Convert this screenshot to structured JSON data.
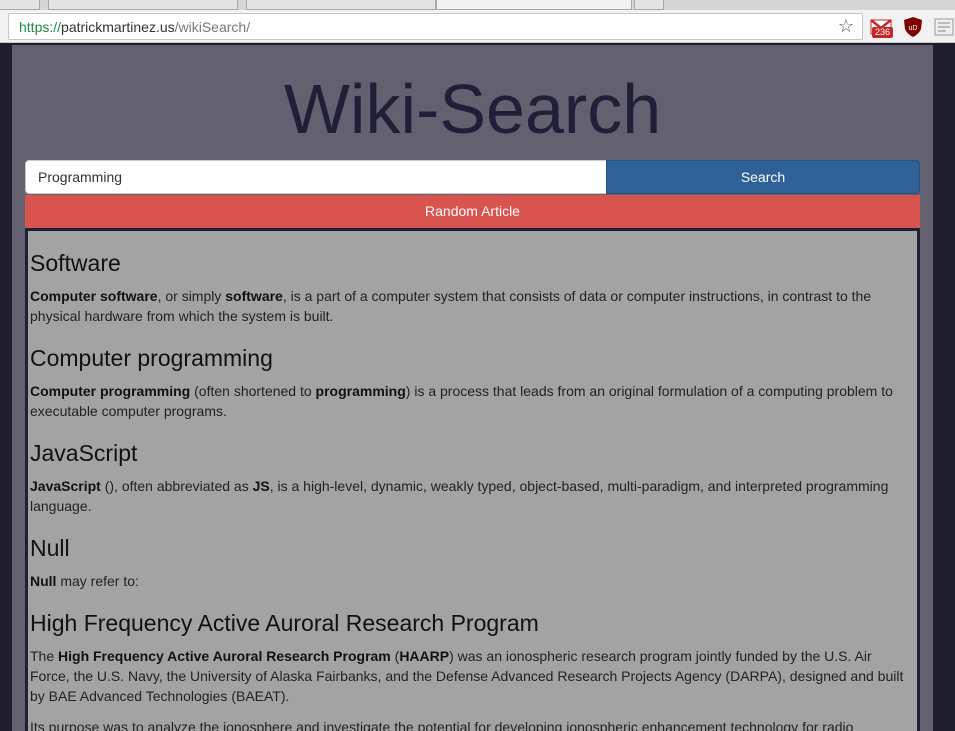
{
  "browser": {
    "url_scheme": "https://",
    "url_host": "patrickmartinez.us",
    "url_path": "/wikiSearch/",
    "gmail_badge": "236",
    "ublock_label": "uD"
  },
  "site": {
    "title": "Wiki-Search",
    "search_value": "Programming",
    "search_button": "Search",
    "random_button": "Random Article"
  },
  "results": [
    {
      "title": "Software",
      "parts": [
        {
          "b": true,
          "t": "Computer software"
        },
        {
          "b": false,
          "t": ", or simply "
        },
        {
          "b": true,
          "t": "software"
        },
        {
          "b": false,
          "t": ", is a part of a computer system that consists of data or computer instructions, in contrast to the physical hardware from which the system is built."
        }
      ]
    },
    {
      "title": "Computer programming",
      "parts": [
        {
          "b": true,
          "t": "Computer programming"
        },
        {
          "b": false,
          "t": " (often shortened to "
        },
        {
          "b": true,
          "t": "programming"
        },
        {
          "b": false,
          "t": ") is a process that leads from an original formulation of a computing problem to executable computer programs."
        }
      ]
    },
    {
      "title": "JavaScript",
      "parts": [
        {
          "b": true,
          "t": "JavaScript"
        },
        {
          "b": false,
          "t": " (), often abbreviated as "
        },
        {
          "b": true,
          "t": "JS"
        },
        {
          "b": false,
          "t": ", is a high-level, dynamic, weakly typed, object-based, multi-paradigm, and interpreted programming language."
        }
      ]
    },
    {
      "title": "Null",
      "parts": [
        {
          "b": true,
          "t": "Null"
        },
        {
          "b": false,
          "t": " may refer to:"
        }
      ]
    },
    {
      "title": "High Frequency Active Auroral Research Program",
      "parts": [
        {
          "b": false,
          "t": "The "
        },
        {
          "b": true,
          "t": "High Frequency Active Auroral Research Program"
        },
        {
          "b": false,
          "t": " ("
        },
        {
          "b": true,
          "t": "HAARP"
        },
        {
          "b": false,
          "t": ") was an ionospheric research program jointly funded by the U.S. Air Force, the U.S. Navy, the University of Alaska Fairbanks, and the Defense Advanced Research Projects Agency (DARPA), designed and built by BAE Advanced Technologies (BAEAT)."
        }
      ],
      "extra": "Its purpose was to analyze the ionosphere and investigate the potential for developing ionospheric enhancement technology for radio"
    }
  ]
}
